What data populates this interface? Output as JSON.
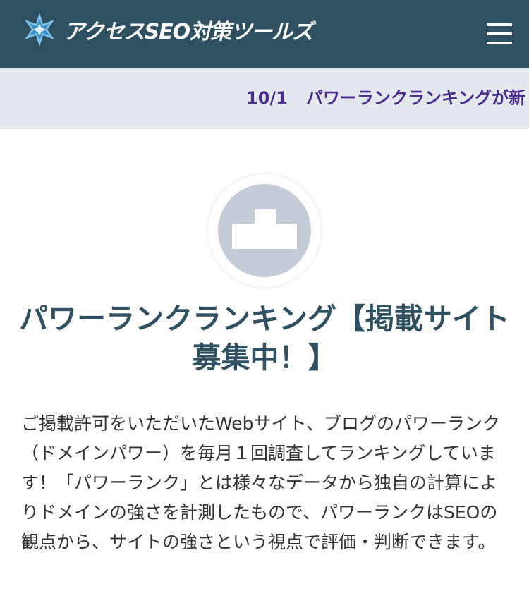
{
  "header": {
    "site_name": "アクセスSEO対策ツールズ",
    "logo_icon": "star-crystal-icon",
    "menu_icon": "hamburger-menu-icon",
    "background_color": "#2f5060"
  },
  "ticker": {
    "date": "10/1",
    "text": "パワーランクランキングが新し",
    "text_color": "#4b2c8f",
    "background_color": "#e2e8ee"
  },
  "main": {
    "avatar_icon": "podium-icon",
    "title": "パワーランクランキング【掲載サイト募集中！】",
    "description": "ご掲載許可をいただいたWebサイト、ブログのパワーランク（ドメインパワー）を毎月１回調査してランキングしています！「パワーランク」とは様々なデータから独自の計算によりドメインの強さを計測したもので、パワーランクはSEOの観点から、サイトの強さという視点で評価・判断できます。"
  }
}
